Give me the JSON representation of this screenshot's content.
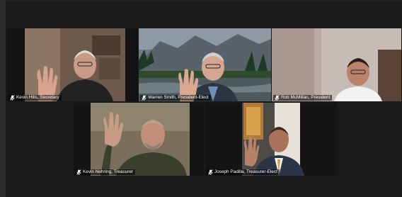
{
  "meeting": {
    "participants": [
      {
        "name": "Kevin Hills, Secretary",
        "muted": true
      },
      {
        "name": "Warren Smith, President-Elect",
        "muted": true
      },
      {
        "name": "Rob McMillan, President",
        "muted": true
      },
      {
        "name": "Kevin Nehring, Treasurer",
        "muted": true
      },
      {
        "name": "Joseph Padilla, Treasurer-Elect",
        "muted": true
      }
    ]
  },
  "icons": {
    "mute": "mic-muted-icon"
  },
  "colors": {
    "background": "#1a1a1a",
    "label_bg": "rgba(0,0,0,0.55)",
    "label_text": "#ffffff"
  }
}
